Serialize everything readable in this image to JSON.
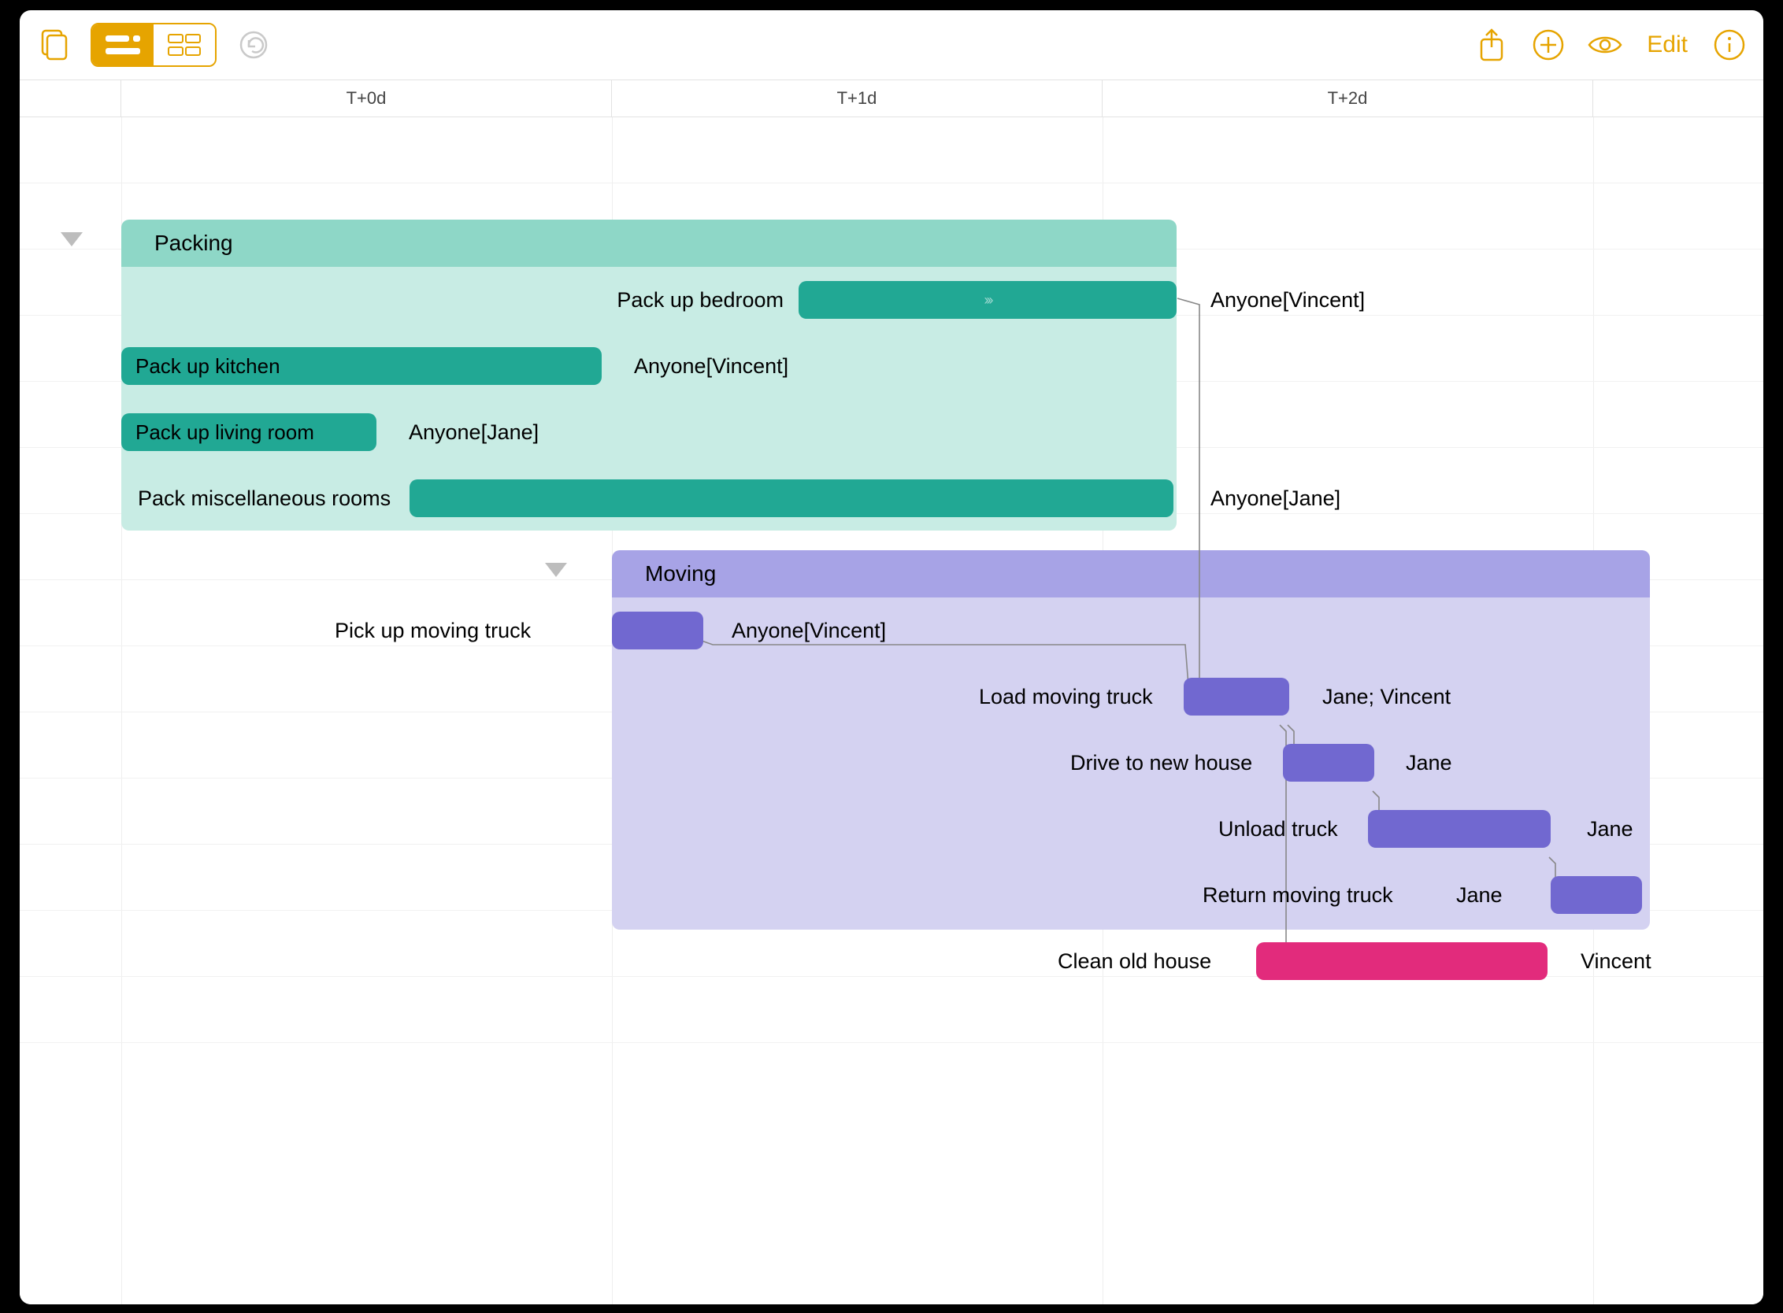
{
  "toolbar": {
    "edit_label": "Edit"
  },
  "time_header": {
    "columns": [
      "T+0d",
      "T+1d",
      "T+2d"
    ]
  },
  "colors": {
    "accent": "#e6a400",
    "teal_head": "#8ed7c7",
    "teal_body": "#c8ece4",
    "teal_bar": "#21a894",
    "purple_head": "#a7a3e6",
    "purple_body": "#d4d2f1",
    "purple_bar": "#7168d0",
    "pink_bar": "#e22b7c"
  },
  "groups": {
    "packing": {
      "title": "Packing"
    },
    "moving": {
      "title": "Moving"
    }
  },
  "tasks": {
    "pack_bedroom": {
      "label": "Pack up bedroom",
      "assignee": "Anyone[Vincent]"
    },
    "pack_kitchen": {
      "label": "Pack up kitchen",
      "assignee": "Anyone[Vincent]"
    },
    "pack_living": {
      "label": "Pack up living room",
      "assignee": "Anyone[Jane]"
    },
    "pack_misc": {
      "label": "Pack miscellaneous rooms",
      "assignee": "Anyone[Jane]"
    },
    "pick_truck": {
      "label": "Pick up moving truck",
      "assignee": "Anyone[Vincent]"
    },
    "load_truck": {
      "label": "Load moving truck",
      "assignee": "Jane; Vincent"
    },
    "drive": {
      "label": "Drive to new house",
      "assignee": "Jane"
    },
    "unload": {
      "label": "Unload truck",
      "assignee": "Jane"
    },
    "return_truck": {
      "label": "Return moving truck",
      "assignee": "Jane"
    },
    "clean": {
      "label": "Clean old house",
      "assignee": "Vincent"
    }
  },
  "chart_data": {
    "type": "gantt",
    "time_unit": "days",
    "time_range": [
      0,
      3
    ],
    "groups": [
      {
        "name": "Packing",
        "tasks": [
          {
            "name": "Pack up bedroom",
            "start": 0.78,
            "end": 1.2,
            "resource": "Anyone[Vincent]"
          },
          {
            "name": "Pack up kitchen",
            "start": 0.0,
            "end": 0.56,
            "resource": "Anyone[Vincent]"
          },
          {
            "name": "Pack up living room",
            "start": 0.0,
            "end": 0.3,
            "resource": "Anyone[Jane]"
          },
          {
            "name": "Pack miscellaneous rooms",
            "start": 0.3,
            "end": 1.28,
            "resource": "Anyone[Jane]"
          }
        ]
      },
      {
        "name": "Moving",
        "tasks": [
          {
            "name": "Pick up moving truck",
            "start": 0.58,
            "end": 0.7,
            "resource": "Anyone[Vincent]"
          },
          {
            "name": "Load moving truck",
            "start": 1.28,
            "end": 1.42,
            "resource": "Jane; Vincent"
          },
          {
            "name": "Drive to new house",
            "start": 1.42,
            "end": 1.55,
            "resource": "Jane"
          },
          {
            "name": "Unload truck",
            "start": 1.55,
            "end": 1.8,
            "resource": "Jane"
          },
          {
            "name": "Return moving truck",
            "start": 1.8,
            "end": 1.9,
            "resource": "Jane"
          }
        ]
      },
      {
        "name": "",
        "tasks": [
          {
            "name": "Clean old house",
            "start": 1.42,
            "end": 1.76,
            "resource": "Vincent"
          }
        ]
      }
    ],
    "dependencies": [
      [
        "Pack up bedroom",
        "Load moving truck"
      ],
      [
        "Pack miscellaneous rooms",
        "Load moving truck"
      ],
      [
        "Pick up moving truck",
        "Load moving truck"
      ],
      [
        "Load moving truck",
        "Drive to new house"
      ],
      [
        "Drive to new house",
        "Unload truck"
      ],
      [
        "Unload truck",
        "Return moving truck"
      ],
      [
        "Load moving truck",
        "Clean old house"
      ]
    ]
  }
}
